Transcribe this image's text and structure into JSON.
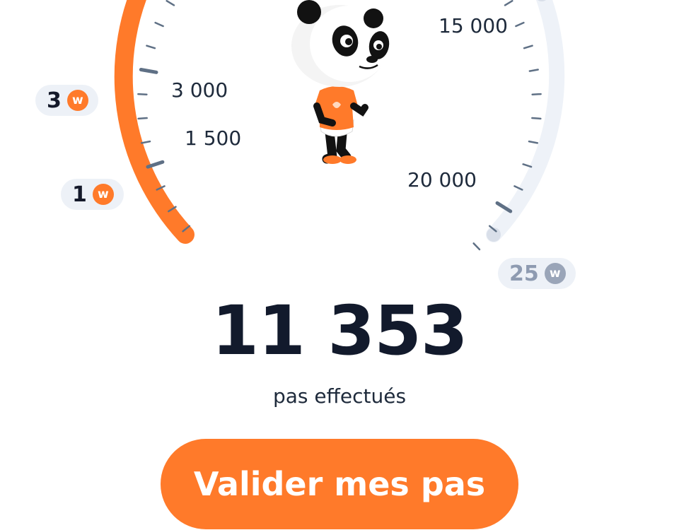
{
  "gauge": {
    "progress_fraction": 0.4541,
    "max_steps": 25000,
    "scale_labels": [
      "1 500",
      "3 000",
      "15 000",
      "20 000"
    ],
    "colors": {
      "filled": "#ff7a2a",
      "track": "#eef2f8",
      "tick": "#5f7085"
    }
  },
  "rewards": [
    {
      "amount": "1",
      "coin_letter": "w",
      "state": "achieved"
    },
    {
      "amount": "3",
      "coin_letter": "w",
      "state": "achieved"
    },
    {
      "amount": "25",
      "coin_letter": "w",
      "state": "pending"
    }
  ],
  "mascot": {
    "name": "panda-mascot",
    "shirt_color": "#ff7a2a"
  },
  "steps": {
    "count": "11 353",
    "caption": "pas effectués"
  },
  "actions": {
    "validate_label": "Valider mes pas"
  }
}
